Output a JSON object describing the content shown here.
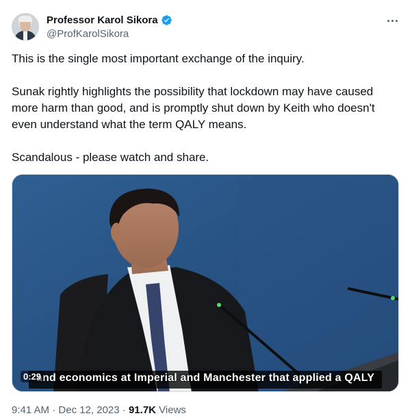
{
  "author": {
    "display_name": "Professor Karol Sikora",
    "handle": "@ProfKarolSikora",
    "verified": true
  },
  "tweet": {
    "paragraphs": [
      "This is the single most important exchange of the inquiry.",
      "Sunak rightly highlights the possibility that lockdown may have caused more harm than good, and is promptly shut down by Keith who doesn't even understand what the term QALY means.",
      "Scandalous - please watch and share."
    ]
  },
  "media": {
    "type": "video",
    "elapsed": "0:29",
    "caption": "and economics at Imperial and Manchester that applied a QALY"
  },
  "meta": {
    "time": "9:41 AM",
    "separator": "·",
    "date": "Dec 12, 2023",
    "views_count": "91.7K",
    "views_label": "Views"
  },
  "colors": {
    "text": "#0f1419",
    "secondary": "#536471",
    "verified": "#1d9bf0",
    "border": "#cfd9de"
  },
  "icons": [
    "verified-badge-icon",
    "more-options-icon"
  ]
}
